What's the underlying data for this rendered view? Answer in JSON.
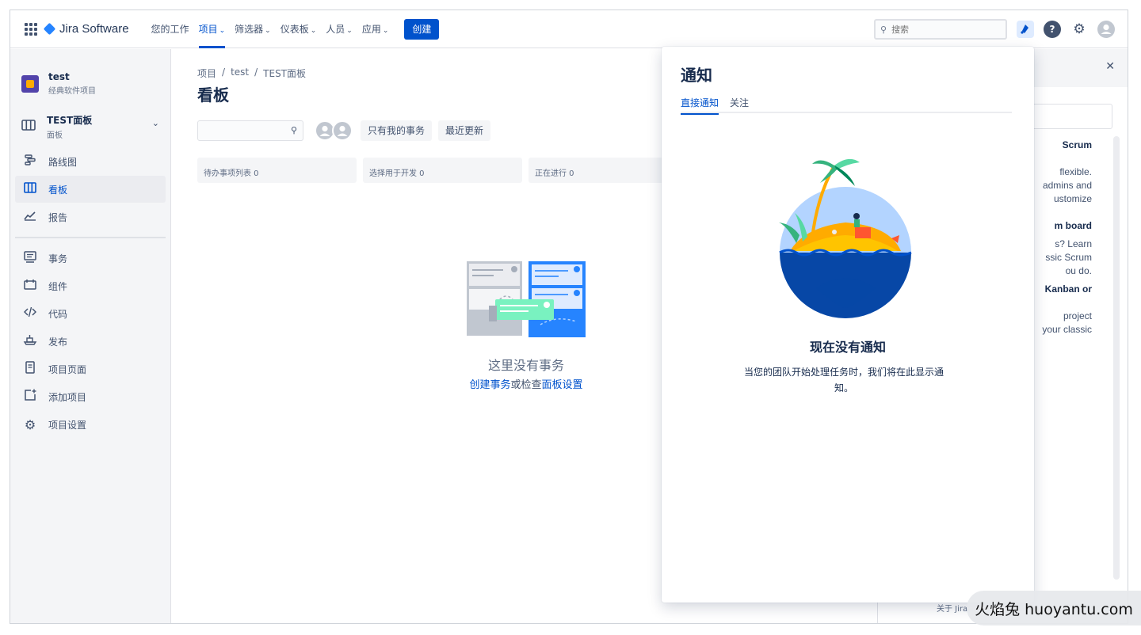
{
  "topnav": {
    "product": "Jira Software",
    "items": [
      {
        "label": "您的工作",
        "chev": ""
      },
      {
        "label": "项目",
        "chev": "⌄"
      },
      {
        "label": "筛选器",
        "chev": "⌄"
      },
      {
        "label": "仪表板",
        "chev": "⌄"
      },
      {
        "label": "人员",
        "chev": "⌄"
      },
      {
        "label": "应用",
        "chev": "⌄"
      }
    ],
    "create_label": "创建",
    "search_placeholder": "搜索"
  },
  "sidebar": {
    "project_name": "test",
    "project_type": "经典软件项目",
    "board_name": "TEST面板",
    "board_sub": "面板",
    "items": [
      {
        "label": "路线图",
        "icon": "roadmap-icon"
      },
      {
        "label": "看板",
        "icon": "board-icon"
      },
      {
        "label": "报告",
        "icon": "reports-icon"
      },
      {
        "label": "事务",
        "icon": "issues-icon"
      },
      {
        "label": "组件",
        "icon": "components-icon"
      },
      {
        "label": "代码",
        "icon": "code-icon"
      },
      {
        "label": "发布",
        "icon": "release-icon"
      },
      {
        "label": "项目页面",
        "icon": "project-pages-icon"
      },
      {
        "label": "添加项目",
        "icon": "add-item-icon"
      },
      {
        "label": "项目设置",
        "icon": "settings-icon"
      }
    ]
  },
  "main": {
    "breadcrumbs": [
      "项目",
      "test",
      "TEST面板"
    ],
    "title": "看板",
    "filters": [
      "只有我的事务",
      "最近更新"
    ],
    "columns": [
      "待办事项列表 0",
      "选择用于开发 0",
      "正在进行 0"
    ],
    "empty_title": "这里没有事务",
    "empty_link1": "创建事务",
    "empty_mid": "或检查",
    "empty_link2": "面板设置"
  },
  "under_panel": {
    "lines": [
      "Scrum",
      "",
      "flexible.",
      "admins and",
      "ustomize",
      "",
      "m board",
      "",
      "s? Learn",
      "ssic Scrum",
      "ou do.",
      "",
      "Kanban or",
      "",
      "project",
      "your classic"
    ],
    "footer": "关于 Jira"
  },
  "notifications": {
    "title": "通知",
    "tabs": [
      "直接通知",
      "关注"
    ],
    "empty_title": "现在没有通知",
    "empty_sub": "当您的团队开始处理任务时，我们将在此显示通知。"
  },
  "watermark": "火焰兔 huoyantu.com",
  "colors": {
    "accent": "#0052CC",
    "sidebar_bg": "#F4F5F7",
    "text": "#172B4D"
  }
}
